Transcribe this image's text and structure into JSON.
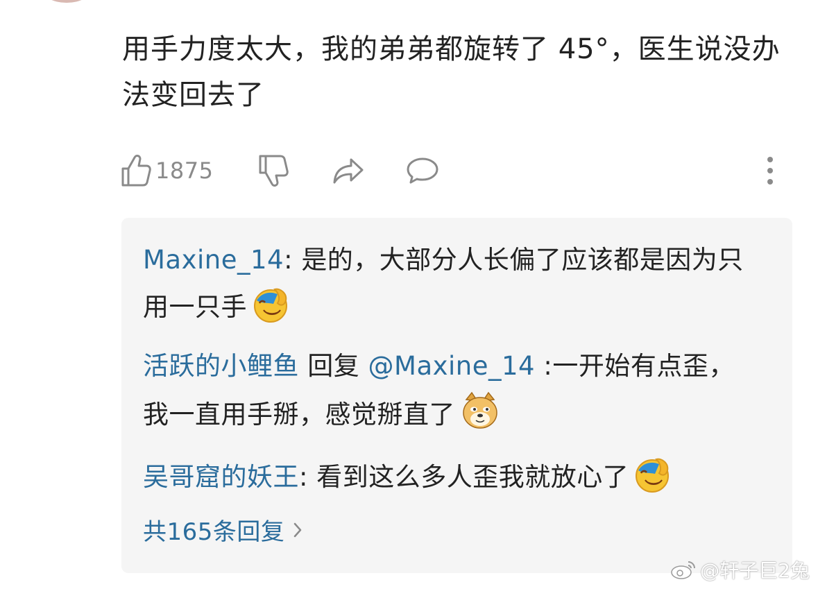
{
  "comment": {
    "text": "用手力度太大，我的弟弟都旋转了 45°，医生说没办法变回去了",
    "like_count": "1875"
  },
  "replies": [
    {
      "user": "Maxine_14",
      "separator": ": ",
      "text": "是的，大部分人长偏了应该都是因为只用一只手",
      "emoji": "facepalm-laugh-emoji"
    },
    {
      "user": "活跃的小鲤鱼",
      "reply_word": " 回复 ",
      "mention": "@Maxine_14",
      "separator": " :",
      "text": "一开始有点歪，我一直用手掰，感觉掰直了",
      "emoji": "doge-emoji"
    },
    {
      "user": "吴哥窟的妖王",
      "separator": ": ",
      "text": "看到这么多人歪我就放心了",
      "emoji": "facepalm-laugh-emoji"
    }
  ],
  "more_replies": {
    "label": "共165条回复"
  },
  "watermark": {
    "text": "@轩子巨2兔"
  },
  "colors": {
    "username": "#2a6c9c",
    "reply_bg": "#f5f5f5",
    "icon_gray": "#8a8a8a"
  }
}
